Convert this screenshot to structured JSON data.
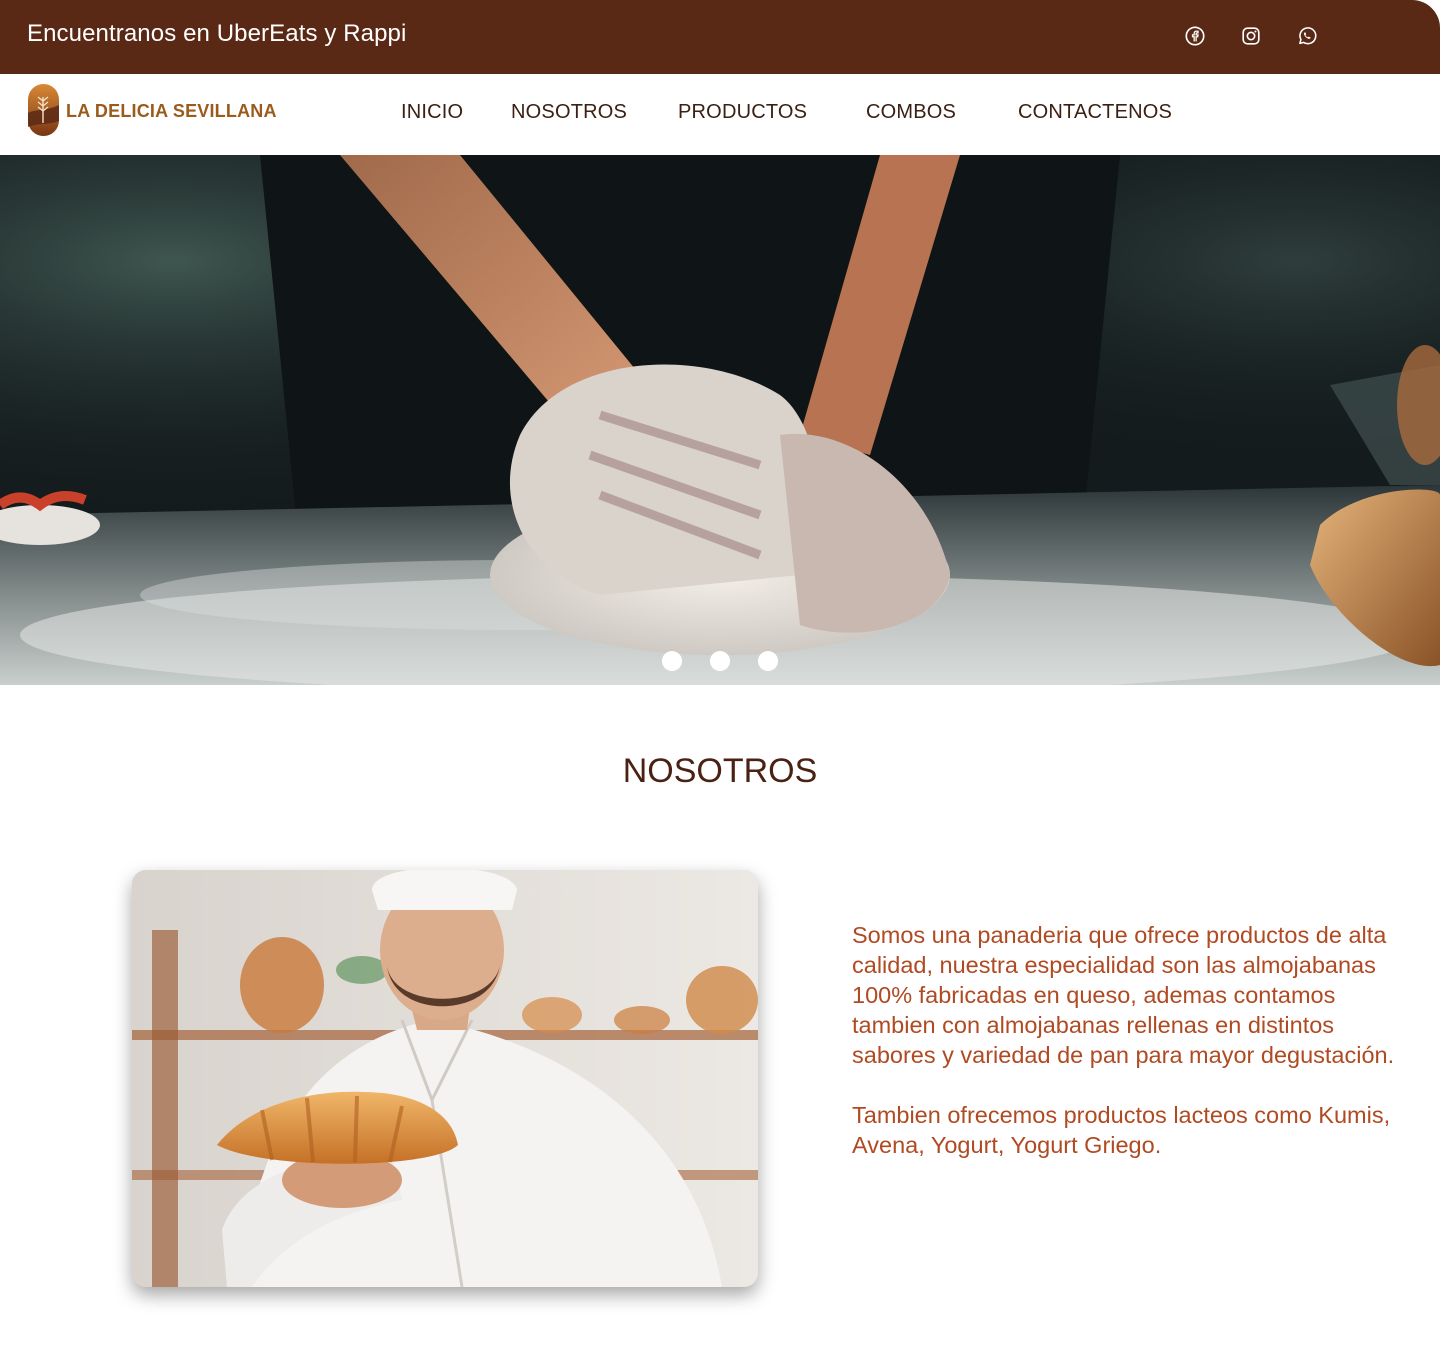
{
  "topbar": {
    "text": "Encuentranos en UberEats y Rappi",
    "social_icons": [
      "facebook-icon",
      "instagram-icon",
      "whatsapp-icon"
    ]
  },
  "brand": {
    "name": "LA DELICIA SEVILLANA"
  },
  "nav": {
    "items": [
      {
        "label": "INICIO"
      },
      {
        "label": "NOSOTROS"
      },
      {
        "label": "PRODUCTOS"
      },
      {
        "label": "COMBOS"
      },
      {
        "label": "CONTACTENOS"
      }
    ]
  },
  "hero": {
    "slides": 3
  },
  "about": {
    "title": "NOSOTROS",
    "paragraphs": [
      "Somos una panaderia que ofrece productos de alta calidad, nuestra especialidad son las almojabanas 100% fabricadas en queso, ademas contamos tambien con almojabanas rellenas en distintos sabores y variedad de pan para mayor degustación.",
      "Tambien ofrecemos productos lacteos como Kumis, Avena, Yogurt, Yogurt Griego."
    ]
  },
  "colors": {
    "topbar": "#5a2916",
    "brand_text": "#9a5b1d",
    "nav_text": "#3b2013",
    "title": "#4a2113",
    "body_text": "#b04a22"
  }
}
